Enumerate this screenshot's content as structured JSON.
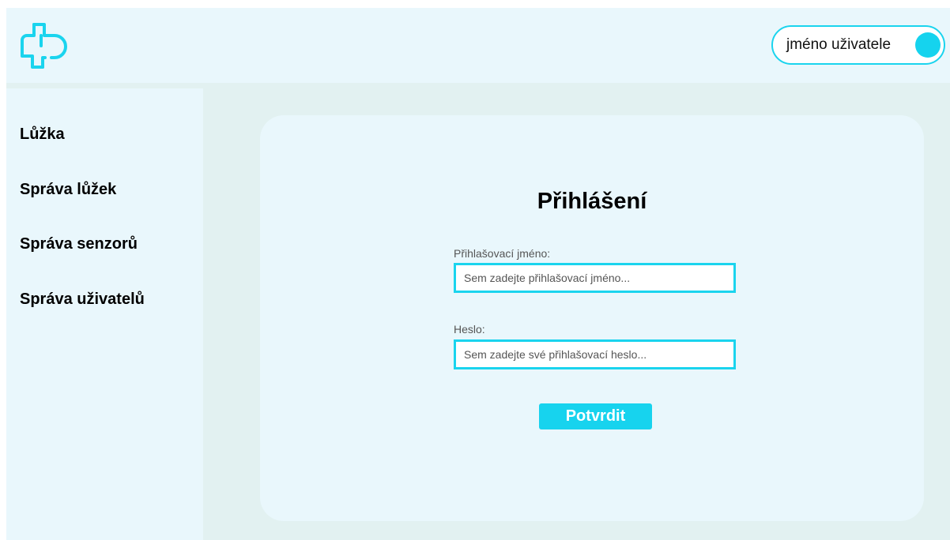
{
  "header": {
    "logo_icon": "medical-cross-outline-icon",
    "user": {
      "name": "jméno uživatele",
      "avatar_icon": "avatar-circle-icon"
    }
  },
  "sidebar": {
    "items": [
      {
        "label": "Lůžka"
      },
      {
        "label": "Správa lůžek"
      },
      {
        "label": "Správa senzorů"
      },
      {
        "label": "Správa uživatelů"
      }
    ]
  },
  "login": {
    "title": "Přihlášení",
    "username": {
      "label": "Přihlašovací jméno:",
      "placeholder": "Sem zadejte přihlašovací jméno...",
      "value": ""
    },
    "password": {
      "label": "Heslo:",
      "placeholder": "Sem zadejte své přihlašovací heslo...",
      "value": ""
    },
    "submit_label": "Potvrdit"
  },
  "colors": {
    "accent": "#1ad4ee",
    "panel": "#e9f7fc",
    "background": "#e2f1f1"
  }
}
